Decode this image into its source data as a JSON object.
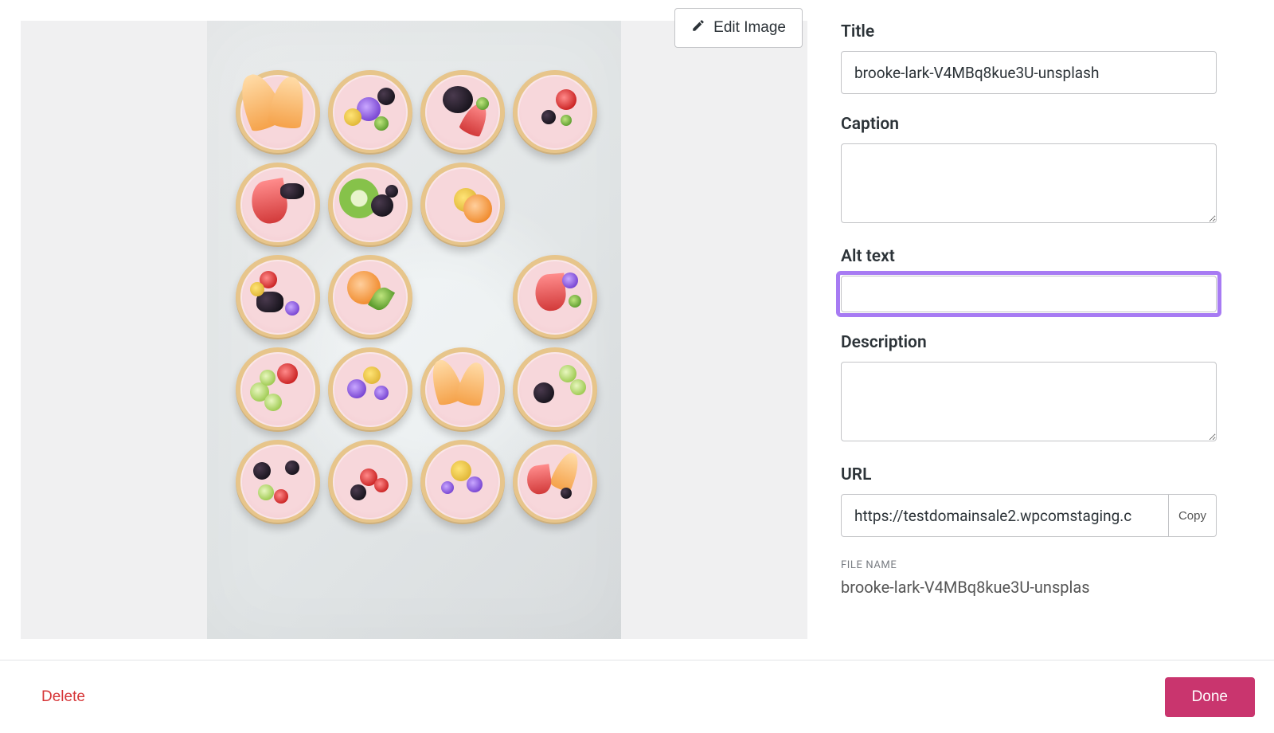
{
  "preview": {
    "edit_label": "Edit Image"
  },
  "form": {
    "title": {
      "label": "Title",
      "value": "brooke-lark-V4MBq8kue3U-unsplash"
    },
    "caption": {
      "label": "Caption",
      "value": ""
    },
    "alt": {
      "label": "Alt text",
      "value": ""
    },
    "description": {
      "label": "Description",
      "value": ""
    },
    "url": {
      "label": "URL",
      "value": "https://testdomainsale2.wpcomstaging.c",
      "copy_label": "Copy"
    },
    "file_name": {
      "label": "FILE NAME",
      "value": "brooke-lark-V4MBq8kue3U-unsplas"
    }
  },
  "footer": {
    "delete_label": "Delete",
    "done_label": "Done"
  }
}
